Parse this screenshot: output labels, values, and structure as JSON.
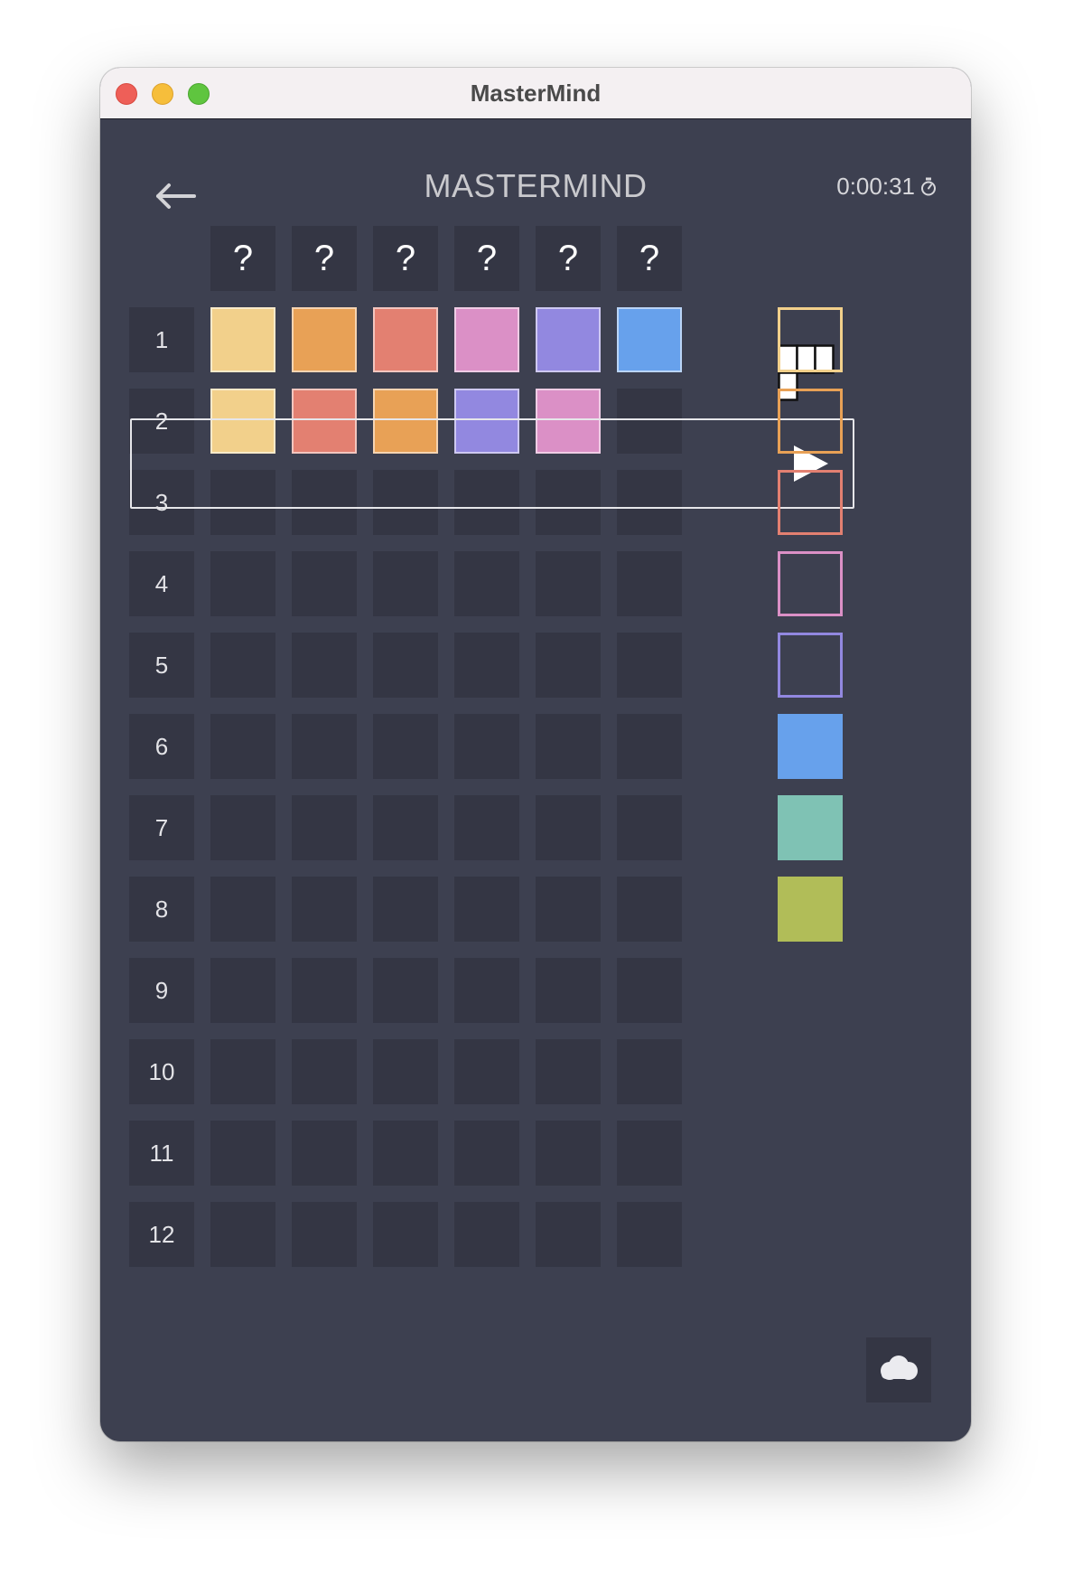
{
  "window": {
    "title": "MasterMind"
  },
  "header": {
    "back_icon": "arrow-left-icon",
    "title": "MASTERMIND",
    "timer": "0:00:31",
    "timer_icon": "stopwatch-icon"
  },
  "secret": [
    "?",
    "?",
    "?",
    "?",
    "?",
    "?"
  ],
  "colors": {
    "yellow": "#f2d08b",
    "orange": "#e8a156",
    "salmon": "#e38071",
    "pink": "#db90c6",
    "purple": "#9288e0",
    "blue": "#67a1ec",
    "teal": "#7fc2b4",
    "olive": "#b1bd58",
    "empty": "#343644"
  },
  "rows": [
    {
      "number": "1",
      "pegs": [
        "yellow",
        "orange",
        "salmon",
        "pink",
        "purple",
        "blue"
      ],
      "feedback": "feedback-pegs-icon"
    },
    {
      "number": "2",
      "pegs": [
        "yellow",
        "salmon",
        "orange",
        "purple",
        "pink",
        null
      ],
      "current": true,
      "action_icon": "play-icon"
    },
    {
      "number": "3",
      "pegs": [
        null,
        null,
        null,
        null,
        null,
        null
      ]
    },
    {
      "number": "4",
      "pegs": [
        null,
        null,
        null,
        null,
        null,
        null
      ]
    },
    {
      "number": "5",
      "pegs": [
        null,
        null,
        null,
        null,
        null,
        null
      ]
    },
    {
      "number": "6",
      "pegs": [
        null,
        null,
        null,
        null,
        null,
        null
      ]
    },
    {
      "number": "7",
      "pegs": [
        null,
        null,
        null,
        null,
        null,
        null
      ]
    },
    {
      "number": "8",
      "pegs": [
        null,
        null,
        null,
        null,
        null,
        null
      ]
    },
    {
      "number": "9",
      "pegs": [
        null,
        null,
        null,
        null,
        null,
        null
      ]
    },
    {
      "number": "10",
      "pegs": [
        null,
        null,
        null,
        null,
        null,
        null
      ]
    },
    {
      "number": "11",
      "pegs": [
        null,
        null,
        null,
        null,
        null,
        null
      ]
    },
    {
      "number": "12",
      "pegs": [
        null,
        null,
        null,
        null,
        null,
        null
      ]
    }
  ],
  "palette": [
    {
      "color": "yellow",
      "style": "outline"
    },
    {
      "color": "orange",
      "style": "outline"
    },
    {
      "color": "salmon",
      "style": "outline"
    },
    {
      "color": "pink",
      "style": "outline"
    },
    {
      "color": "purple",
      "style": "outline"
    },
    {
      "color": "blue",
      "style": "filled"
    },
    {
      "color": "teal",
      "style": "filled"
    },
    {
      "color": "olive",
      "style": "filled"
    }
  ],
  "cloud_icon": "cloud-icon"
}
